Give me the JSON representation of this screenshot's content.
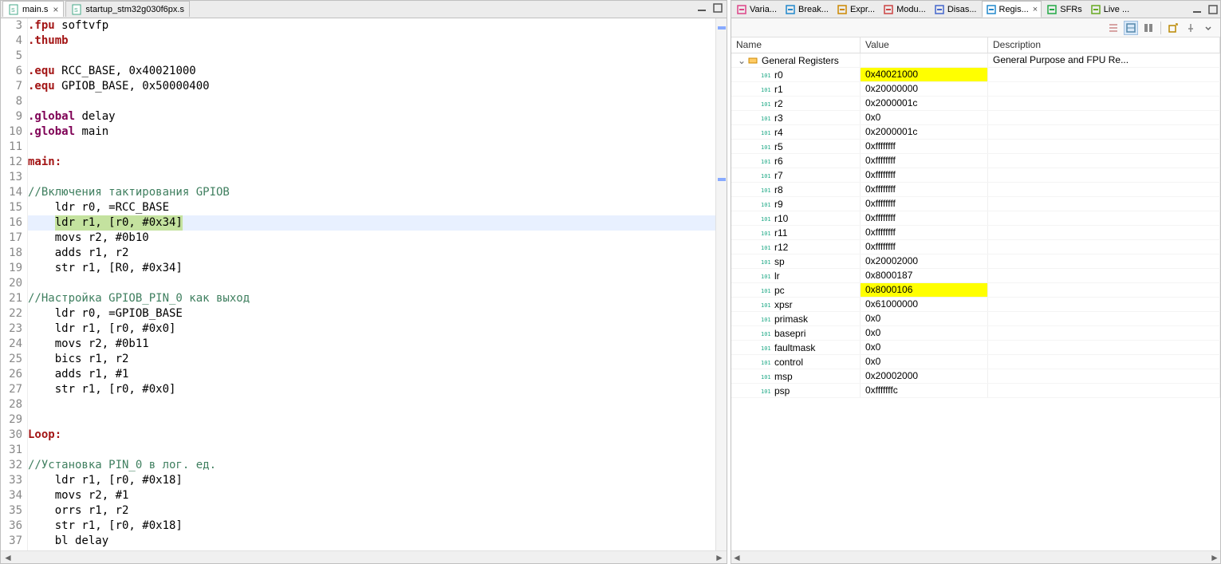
{
  "editor": {
    "tabs": [
      {
        "label": "main.s",
        "active": true
      },
      {
        "label": "startup_stm32g030f6px.s",
        "active": false
      }
    ],
    "lines": [
      {
        "n": 3,
        "segments": [
          {
            "t": ".fpu ",
            "c": "dir"
          },
          {
            "t": "softvfp",
            "c": "id"
          }
        ]
      },
      {
        "n": 4,
        "segments": [
          {
            "t": ".thumb",
            "c": "dir"
          }
        ]
      },
      {
        "n": 5,
        "segments": []
      },
      {
        "n": 6,
        "segments": [
          {
            "t": ".equ ",
            "c": "dir"
          },
          {
            "t": "RCC_BASE, 0x40021000",
            "c": "id"
          }
        ]
      },
      {
        "n": 7,
        "segments": [
          {
            "t": ".equ ",
            "c": "dir"
          },
          {
            "t": "GPIOB_BASE, 0x50000400",
            "c": "id"
          }
        ]
      },
      {
        "n": 8,
        "segments": []
      },
      {
        "n": 9,
        "segments": [
          {
            "t": ".global ",
            "c": "kw"
          },
          {
            "t": "delay",
            "c": "id"
          }
        ]
      },
      {
        "n": 10,
        "segments": [
          {
            "t": ".global ",
            "c": "kw"
          },
          {
            "t": "main",
            "c": "id"
          }
        ]
      },
      {
        "n": 11,
        "segments": []
      },
      {
        "n": 12,
        "segments": [
          {
            "t": "main:",
            "c": "label"
          }
        ]
      },
      {
        "n": 13,
        "segments": []
      },
      {
        "n": 14,
        "segments": [
          {
            "t": "//Включения тактирования GPIOB",
            "c": "cmt"
          }
        ]
      },
      {
        "n": 15,
        "indent": 4,
        "segments": [
          {
            "t": "ldr r0, =RCC_BASE",
            "c": "id"
          }
        ]
      },
      {
        "n": 16,
        "indent": 4,
        "current": true,
        "hl": true,
        "segments": [
          {
            "t": "ldr r1, [r0, #0x34]",
            "c": "id"
          }
        ]
      },
      {
        "n": 17,
        "indent": 4,
        "segments": [
          {
            "t": "movs r2, #0b10",
            "c": "id"
          }
        ]
      },
      {
        "n": 18,
        "indent": 4,
        "segments": [
          {
            "t": "adds r1, r2",
            "c": "id"
          }
        ]
      },
      {
        "n": 19,
        "indent": 4,
        "segments": [
          {
            "t": "str r1, [R0, #0x34]",
            "c": "id"
          }
        ]
      },
      {
        "n": 20,
        "segments": []
      },
      {
        "n": 21,
        "segments": [
          {
            "t": "//Настройка GPIOB_PIN_0 как выход",
            "c": "cmt"
          }
        ]
      },
      {
        "n": 22,
        "indent": 4,
        "segments": [
          {
            "t": "ldr r0, =GPIOB_BASE",
            "c": "id"
          }
        ]
      },
      {
        "n": 23,
        "indent": 4,
        "segments": [
          {
            "t": "ldr r1, [r0, #0x0]",
            "c": "id"
          }
        ]
      },
      {
        "n": 24,
        "indent": 4,
        "segments": [
          {
            "t": "movs r2, #0b11",
            "c": "id"
          }
        ]
      },
      {
        "n": 25,
        "indent": 4,
        "segments": [
          {
            "t": "bics r1, r2",
            "c": "id"
          }
        ]
      },
      {
        "n": 26,
        "indent": 4,
        "segments": [
          {
            "t": "adds r1, #1",
            "c": "id"
          }
        ]
      },
      {
        "n": 27,
        "indent": 4,
        "segments": [
          {
            "t": "str r1, [r0, #0x0]",
            "c": "id"
          }
        ]
      },
      {
        "n": 28,
        "segments": []
      },
      {
        "n": 29,
        "segments": []
      },
      {
        "n": 30,
        "segments": [
          {
            "t": "Loop:",
            "c": "label"
          }
        ]
      },
      {
        "n": 31,
        "segments": []
      },
      {
        "n": 32,
        "segments": [
          {
            "t": "//Установка PIN_0 в лог. ед.",
            "c": "cmt"
          }
        ]
      },
      {
        "n": 33,
        "indent": 4,
        "segments": [
          {
            "t": "ldr r1, [r0, #0x18]",
            "c": "id"
          }
        ]
      },
      {
        "n": 34,
        "indent": 4,
        "segments": [
          {
            "t": "movs r2, #1",
            "c": "id"
          }
        ]
      },
      {
        "n": 35,
        "indent": 4,
        "segments": [
          {
            "t": "orrs r1, r2",
            "c": "id"
          }
        ]
      },
      {
        "n": 36,
        "indent": 4,
        "segments": [
          {
            "t": "str r1, [r0, #0x18]",
            "c": "id"
          }
        ]
      },
      {
        "n": 37,
        "indent": 4,
        "segments": [
          {
            "t": "bl delay",
            "c": "id"
          }
        ]
      }
    ]
  },
  "right": {
    "tabs": [
      {
        "label": "Varia...",
        "icon": "var"
      },
      {
        "label": "Break...",
        "icon": "bp"
      },
      {
        "label": "Expr...",
        "icon": "expr"
      },
      {
        "label": "Modu...",
        "icon": "mod"
      },
      {
        "label": "Disas...",
        "icon": "disas"
      },
      {
        "label": "Regis...",
        "icon": "reg",
        "active": true
      },
      {
        "label": "SFRs",
        "icon": "sfr"
      },
      {
        "label": "Live ...",
        "icon": "live"
      }
    ],
    "columns": {
      "name": "Name",
      "value": "Value",
      "desc": "Description"
    },
    "group": {
      "label": "General Registers",
      "desc": "General Purpose and FPU Re..."
    },
    "registers": [
      {
        "name": "r0",
        "value": "0x40021000",
        "hl": true
      },
      {
        "name": "r1",
        "value": "0x20000000"
      },
      {
        "name": "r2",
        "value": "0x2000001c"
      },
      {
        "name": "r3",
        "value": "0x0"
      },
      {
        "name": "r4",
        "value": "0x2000001c"
      },
      {
        "name": "r5",
        "value": "0xffffffff"
      },
      {
        "name": "r6",
        "value": "0xffffffff"
      },
      {
        "name": "r7",
        "value": "0xffffffff"
      },
      {
        "name": "r8",
        "value": "0xffffffff"
      },
      {
        "name": "r9",
        "value": "0xffffffff"
      },
      {
        "name": "r10",
        "value": "0xffffffff"
      },
      {
        "name": "r11",
        "value": "0xffffffff"
      },
      {
        "name": "r12",
        "value": "0xffffffff"
      },
      {
        "name": "sp",
        "value": "0x20002000"
      },
      {
        "name": "lr",
        "value": "0x8000187"
      },
      {
        "name": "pc",
        "value": "0x8000106",
        "hl": true
      },
      {
        "name": "xpsr",
        "value": "0x61000000"
      },
      {
        "name": "primask",
        "value": "0x0"
      },
      {
        "name": "basepri",
        "value": "0x0"
      },
      {
        "name": "faultmask",
        "value": "0x0"
      },
      {
        "name": "control",
        "value": "0x0"
      },
      {
        "name": "msp",
        "value": "0x20002000"
      },
      {
        "name": "psp",
        "value": "0xfffffffc"
      }
    ]
  }
}
